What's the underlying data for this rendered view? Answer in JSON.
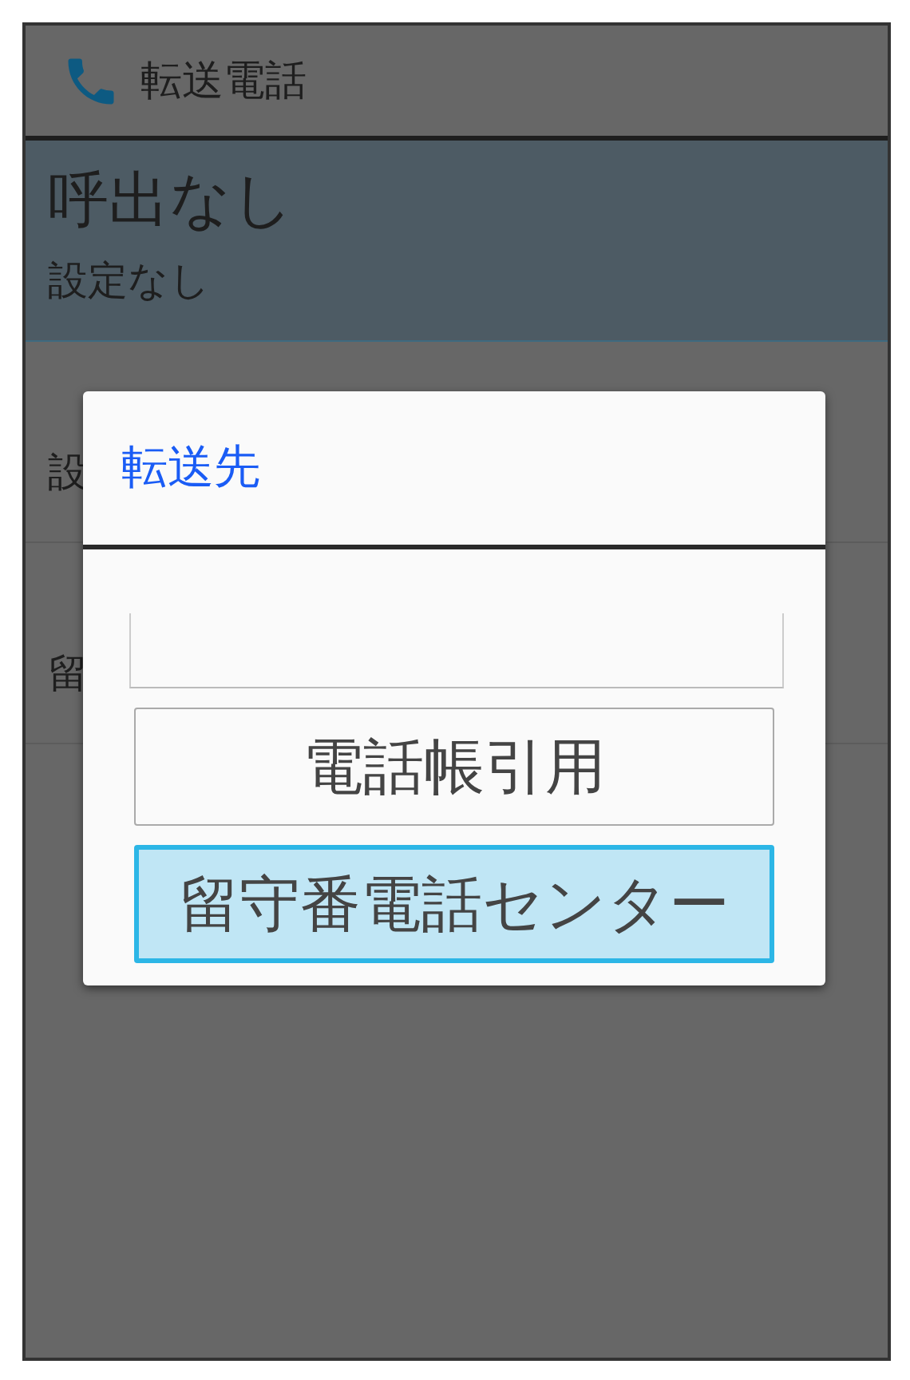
{
  "header": {
    "title": "転送電話"
  },
  "list": [
    {
      "title": "呼出なし",
      "subtitle": "設定なし",
      "selected": true
    },
    {
      "subtitle": "設",
      "selected": false
    },
    {
      "subtitle": "留",
      "selected": false
    }
  ],
  "dialog": {
    "title": "転送先",
    "input": {
      "kind": "text"
    },
    "buttons": [
      {
        "label": "電話帳引用",
        "selected": false
      },
      {
        "label": "留守番電話センター",
        "selected": true
      }
    ]
  }
}
